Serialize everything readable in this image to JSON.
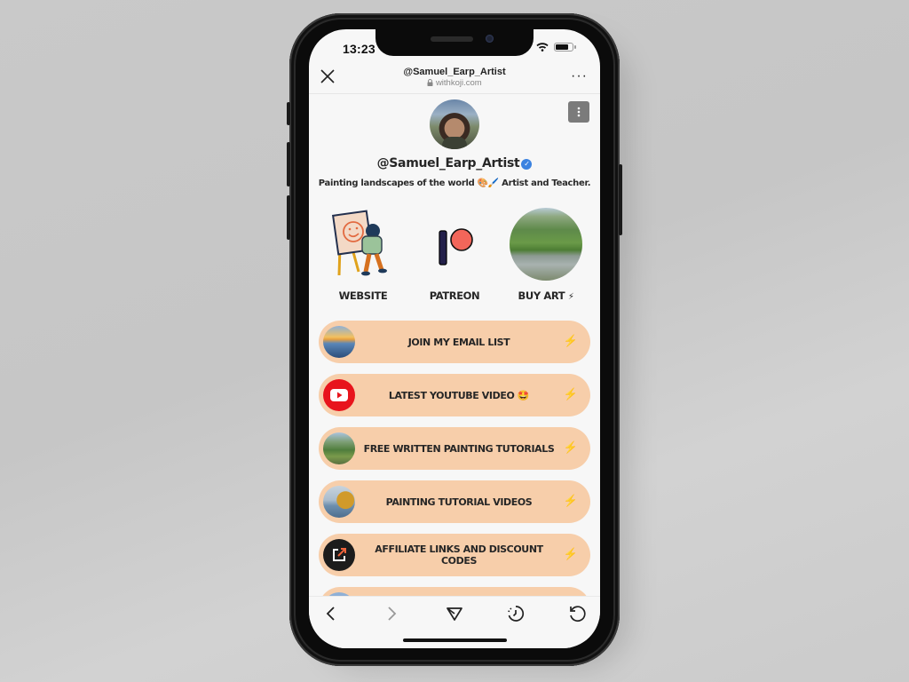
{
  "status_bar": {
    "time": "13:23"
  },
  "browser": {
    "title": "@Samuel_Earp_Artist",
    "domain": "withkoji.com",
    "close_icon": "close-icon",
    "more_icon": "more-horizontal-icon"
  },
  "profile": {
    "username": "@Samuel_Earp_Artist",
    "verified": true,
    "bio": "Painting landscapes of the world 🎨🖌️ Artist and Teacher."
  },
  "featured": [
    {
      "label": "WEBSITE",
      "icon": "painter-illustration",
      "bolt": false
    },
    {
      "label": "PATREON",
      "icon": "patreon-logo",
      "bolt": false
    },
    {
      "label": "BUY ART",
      "icon": "river-landscape-photo",
      "bolt": true
    }
  ],
  "links": [
    {
      "label": "JOIN MY EMAIL LIST",
      "thumb": "ocean-sunset"
    },
    {
      "label": "LATEST YOUTUBE VIDEO 🤩",
      "thumb": "youtube"
    },
    {
      "label": "FREE WRITTEN PAINTING TUTORIALS",
      "thumb": "green-landscape"
    },
    {
      "label": "PAINTING TUTORIAL VIDEOS",
      "thumb": "autumn-tree"
    },
    {
      "label": "AFFILIATE LINKS AND DISCOUNT CODES",
      "thumb": "external-link"
    },
    {
      "label": "",
      "thumb": "partial"
    }
  ],
  "bolt_glyph": "⚡",
  "colors": {
    "link_bg": "#f7ceaa",
    "verified": "#3b82e0",
    "patreon_red": "#f2665a",
    "patreon_navy": "#23204a"
  },
  "toolbar": [
    "back",
    "forward",
    "share",
    "history",
    "reload"
  ]
}
